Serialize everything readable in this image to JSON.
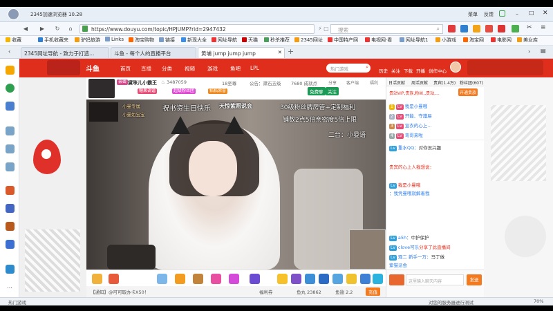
{
  "window": {
    "title": "2345加速浏览器 10.28",
    "right_actions": [
      "菜单",
      "反馈",
      "皮肤"
    ]
  },
  "nav": {
    "url": "https://www.douyu.com/topic/HPJUMP?rid=2947432",
    "search_placeholder": "搜索"
  },
  "favorites": [
    "收藏",
    "手机收藏夹",
    "驴妈旅游",
    "Links",
    "淘宝购物",
    "链接",
    "新现大全",
    "网址导航",
    "天猫",
    "秒杀推荐",
    "2345网址",
    "中国特产网",
    "电视网·看",
    "网址导航1",
    "小游戏",
    "淘宝网",
    "电影网",
    "美女库"
  ],
  "tabs": [
    {
      "label": "2345网址导航 - 致力于打造…"
    },
    {
      "label": "斗鱼 - 每个人的直播平台"
    },
    {
      "label": "黄埔 jump jump jump"
    }
  ],
  "site": {
    "logo": "斗鱼",
    "nav_items": [
      "首页",
      "直播",
      "分类",
      "视频",
      "游戏",
      "鱼吧",
      "LPL"
    ],
    "search_placeholder": "热门游戏",
    "header_actions": [
      "历史",
      "关注",
      "下载",
      "开播",
      "创作中心"
    ]
  },
  "room": {
    "streamer_tags": [
      "亲密",
      "糖果调谐",
      "超级粉丝团",
      "粘粘荣誉"
    ],
    "streamer_name": "黛咪儿小霸王",
    "hot": "3487059",
    "rank": "18至尊",
    "notice": "公告：黛石五级",
    "followers": "7680 成就点",
    "actions": [
      "分享",
      "客户端",
      "福利"
    ],
    "buttons": [
      "免费聊",
      "关注"
    ]
  },
  "overlay": {
    "line1": "祝书资生日快乐",
    "line2": "天惊紫照说会",
    "line3": "30级粉丝牌房管+定制福利",
    "line4": "铺数2点5倍亲密度5倍上限",
    "line5": "二台：小曼语",
    "badge1": "小曼专属",
    "badge2": "小曼姐宝宝"
  },
  "chat": {
    "tabs": [
      "日活贡献",
      "周活贡献",
      "贵宾(1.4万)",
      "粉丝团(607)"
    ],
    "vip_notice": "贵站VIP,贵族,粉丝,,贵站,...",
    "open_button": "开通贵族",
    "ranking": [
      {
        "name": "我是小曼哦"
      },
      {
        "name": "开能、守護屎"
      },
      {
        "name": "宣衣的心上..."
      },
      {
        "name": "弯哥来啦"
      }
    ],
    "messages": [
      {
        "user": "重水QQ：",
        "text": "对你没兴趣"
      },
      {
        "user": "贵宾的心上人我想说：",
        "text": ""
      },
      {
        "user": "我是小曼哦",
        "text": "：我凭曼哦就解着我"
      },
      {
        "user": "a5h：",
        "text": "中护保护"
      },
      {
        "user": "clove可乐",
        "text": "分享了此直播间"
      },
      {
        "user": "观二 新手一万：",
        "text": "马丁做"
      },
      {
        "user": "紫猫派会",
        "text": ""
      }
    ],
    "input_placeholder": "这里输入聊天内容",
    "send_label": "发送"
  },
  "footer": {
    "notice": "【通知】@可可取办卡X50！",
    "fish_ball": "鱼丸 23862",
    "fish_wing": "鱼翅 2.2",
    "recharge": "充值",
    "welfare": "福利券"
  },
  "status": {
    "left": "热门游戏",
    "middle": "对您的服务器进行测试",
    "zoom": "70%"
  },
  "colors": {
    "brand": "#e02e1c",
    "accent": "#f37a1f",
    "chat_user": "#2b7de9"
  }
}
